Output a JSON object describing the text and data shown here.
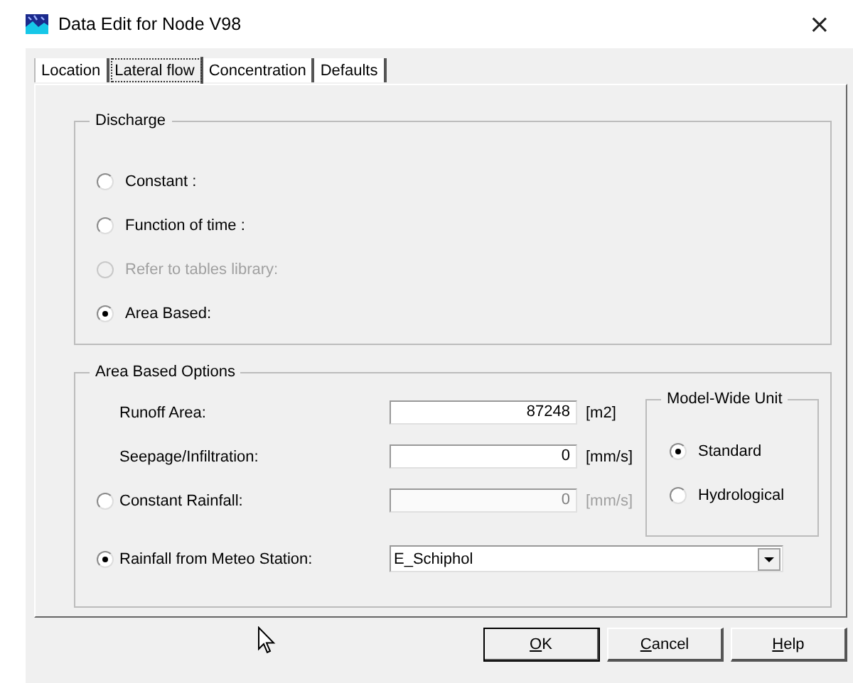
{
  "window": {
    "title": "Data Edit for Node V98",
    "close": "×"
  },
  "tabs": [
    {
      "label": "Location",
      "selected": false
    },
    {
      "label": "Lateral flow",
      "selected": true
    },
    {
      "label": "Concentration",
      "selected": false
    },
    {
      "label": "Defaults",
      "selected": false
    }
  ],
  "discharge": {
    "title": "Discharge",
    "options": [
      {
        "label": "Constant :",
        "selected": false,
        "disabled": false
      },
      {
        "label": "Function of time :",
        "selected": false,
        "disabled": false
      },
      {
        "label": "Refer to tables library:",
        "selected": false,
        "disabled": true
      },
      {
        "label": "Area Based:",
        "selected": true,
        "disabled": false
      }
    ]
  },
  "area_based_options": {
    "title": "Area Based Options",
    "fields": [
      {
        "kind": "input",
        "label": "Runoff Area:",
        "value": "87248",
        "unit": "[m2]",
        "disabled": false
      },
      {
        "kind": "input",
        "label": "Seepage/Infiltration:",
        "value": "0",
        "unit": "[mm/s]",
        "disabled": false
      },
      {
        "kind": "radio-input",
        "label": "Constant Rainfall:",
        "selected": false,
        "value": "0",
        "unit": "[mm/s]",
        "disabled": true
      },
      {
        "kind": "radio-dropdown",
        "label": "Rainfall from Meteo Station:",
        "selected": true,
        "value": "E_Schiphol",
        "disabled": false
      }
    ],
    "model_wide_unit": {
      "title": "Model-Wide Unit",
      "options": [
        {
          "label": "Standard",
          "selected": true
        },
        {
          "label": "Hydrological",
          "selected": false
        }
      ]
    }
  },
  "buttons": [
    {
      "label": "OK",
      "default": true
    },
    {
      "label": "Cancel",
      "default": false
    },
    {
      "label": "Help",
      "default": false
    }
  ]
}
